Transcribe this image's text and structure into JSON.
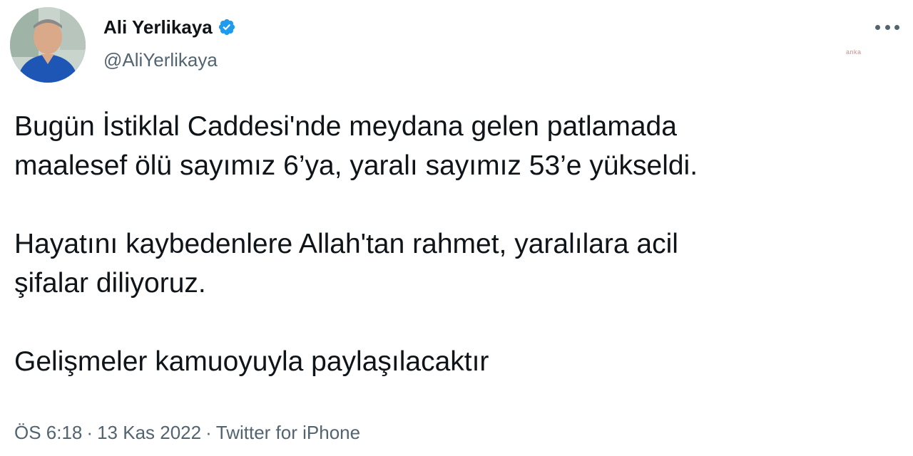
{
  "author": {
    "name": "Ali Yerlikaya",
    "handle": "@AliYerlikaya",
    "verified": true
  },
  "watermark": "anka",
  "tweet": {
    "line1": "Bugün İstiklal Caddesi'nde meydana gelen patlamada",
    "line2": "maalesef ölü sayımız 6’ya, yaralı sayımız 53’e yükseldi.",
    "line3": "Hayatını kaybedenlere Allah'tan rahmet, yaralılara acil",
    "line4": "şifalar diliyoruz.",
    "line5": "Gelişmeler kamuoyuyla paylaşılacaktır"
  },
  "meta": {
    "time": "ÖS 6:18",
    "separator": "·",
    "date": "13 Kas 2022",
    "source": "Twitter for iPhone"
  },
  "icons": {
    "verified": "verified-badge-icon",
    "more": "more-options-icon"
  },
  "colors": {
    "text": "#0f1419",
    "secondary": "#536471",
    "verified": "#1d9bf0"
  }
}
